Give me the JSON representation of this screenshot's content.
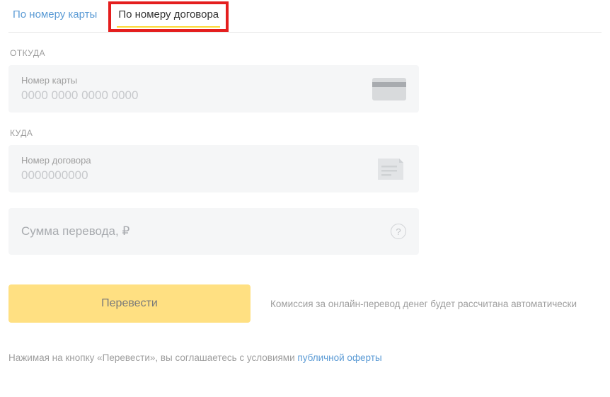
{
  "tabs": {
    "by_card": "По номеру карты",
    "by_contract": "По номеру договора"
  },
  "from": {
    "section_label": "ОТКУДА",
    "input_label": "Номер карты",
    "placeholder": "0000 0000 0000 0000"
  },
  "to": {
    "section_label": "КУДА",
    "input_label": "Номер договора",
    "placeholder": "0000000000"
  },
  "amount": {
    "placeholder": "Сумма перевода, ₽",
    "help": "?"
  },
  "action": {
    "button": "Перевести",
    "commission": "Комиссия за онлайн-перевод денег будет рассчитана автоматически"
  },
  "agreement": {
    "prefix": "Нажимая на кнопку «Перевести», вы соглашаетесь с условиями ",
    "link": "публичной оферты"
  }
}
